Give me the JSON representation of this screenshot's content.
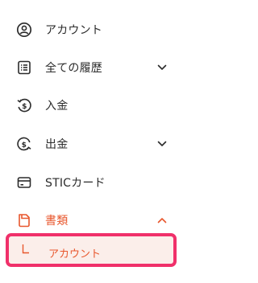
{
  "menu": {
    "account": {
      "label": "アカウント",
      "icon": "user-circle-icon"
    },
    "history": {
      "label": "全ての履歴",
      "icon": "list-icon"
    },
    "deposit": {
      "label": "入金",
      "icon": "deposit-icon"
    },
    "withdraw": {
      "label": "出金",
      "icon": "withdraw-icon"
    },
    "card": {
      "label": "STICカード",
      "icon": "card-icon"
    },
    "documents": {
      "label": "書類",
      "icon": "document-icon"
    },
    "documents_sub": {
      "label": "アカウント"
    }
  },
  "colors": {
    "text": "#2b2b2b",
    "accent": "#e8572d",
    "highlight_border": "#f0306a",
    "highlight_bg": "#fbeeea"
  }
}
